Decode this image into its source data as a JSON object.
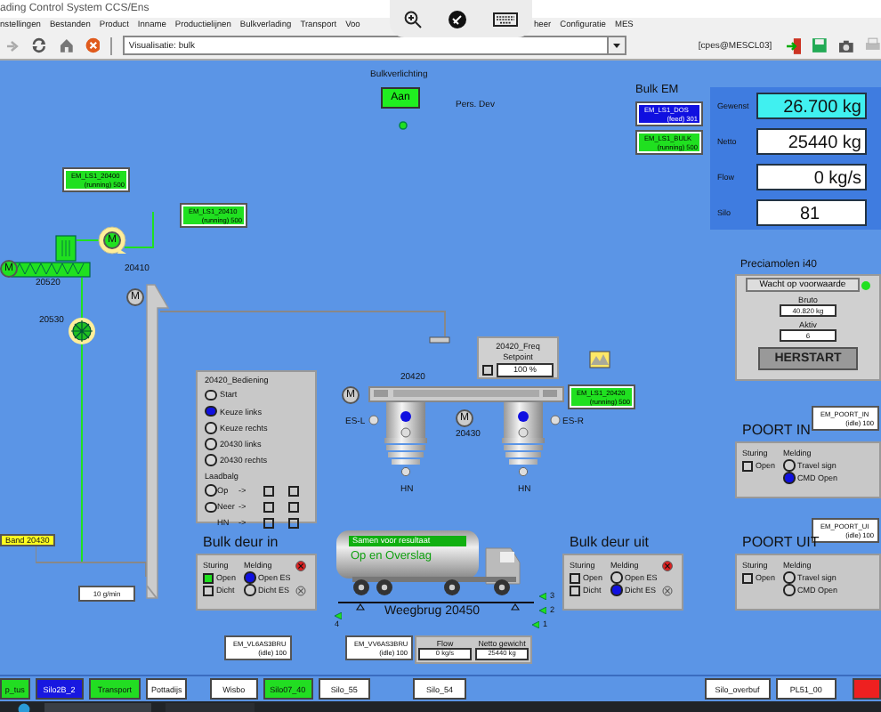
{
  "window": {
    "title": "ading Control System CCS/Ens"
  },
  "menu_left": [
    "nstellingen",
    "Bestanden",
    "Product",
    "Inname",
    "Productielijnen",
    "Bulkverlading",
    "Transport",
    "Voo"
  ],
  "menu_right": [
    "heer",
    "Configuratie",
    "MES"
  ],
  "toolbar": {
    "view": "Visualisatie: bulk",
    "user": "[cpes@MESCL03]"
  },
  "diagram": {
    "lighting": {
      "title": "Bulkverlichting",
      "button": "Aan",
      "on": true
    },
    "labels": [
      "Pers. Dev",
      "20520",
      "20530",
      "20410",
      "20420",
      "20430",
      "ES-L",
      "ES-R",
      "HN",
      "HN"
    ],
    "motors": [
      {
        "letter": "M",
        "running": true
      },
      {
        "letter": "M",
        "running": true
      },
      {
        "letter": "M",
        "running": false
      },
      {
        "letter": "M",
        "running": false
      },
      {
        "letter": "M",
        "running": false
      }
    ],
    "tags": [
      {
        "name": "EM_LS1_DOS",
        "state": "(feed) 301",
        "color": "#1010e0"
      },
      {
        "name": "EM_LS1_BULK",
        "state": "(running) 500",
        "color": "#20e020"
      },
      {
        "name": "EM_LS1_20400",
        "state": "(running) 500",
        "color": "#20e020"
      },
      {
        "name": "EM_LS1_20410",
        "state": "(running) 500",
        "color": "#20e020"
      },
      {
        "name": "EM_LS1_20420",
        "state": "(running) 500",
        "color": "#20e020"
      },
      {
        "name": "EM_POORT_IN",
        "state": "(idle) 100",
        "color": "#ffffff"
      },
      {
        "name": "EM_POORT_UI",
        "state": "(idle) 100",
        "color": "#ffffff"
      },
      {
        "name": "EM_VL6AS3BRU",
        "state": "(idle) 100",
        "color": "#ffffff"
      },
      {
        "name": "EM_VV6AS3BRU",
        "state": "(idle) 100",
        "color": "#ffffff"
      }
    ],
    "bulk_em": {
      "title": "Bulk EM",
      "rows": [
        {
          "label": "Gewenst",
          "value": "26.700 kg",
          "highlight": true
        },
        {
          "label": "Netto",
          "value": "25440 kg",
          "highlight": false
        },
        {
          "label": "Flow",
          "value": "0 kg/s",
          "highlight": false
        },
        {
          "label": "Silo",
          "value": "81",
          "highlight": false
        }
      ]
    },
    "control": {
      "title": "20420_Bediening",
      "options": [
        {
          "label": "Start",
          "selected": false
        },
        {
          "label": "Keuze links",
          "selected": true
        },
        {
          "label": "Keuze rechts",
          "selected": false
        },
        {
          "label": "20430 links",
          "selected": false
        },
        {
          "label": "20430 rechts",
          "selected": false
        }
      ],
      "section": "Laadbalg",
      "rows": [
        {
          "kind": "radio",
          "label": "Op",
          "arrow": "->",
          "selected": false,
          "checks": [
            {
              "checked": false
            },
            {
              "checked": false
            }
          ]
        },
        {
          "kind": "radio",
          "label": "Neer",
          "arrow": "->",
          "selected": false,
          "checks": [
            {
              "checked": false
            },
            {
              "checked": false
            }
          ]
        },
        {
          "kind": "plain",
          "label": "HN",
          "arrow": "->",
          "checks": [
            {
              "checked": false
            },
            {
              "checked": false
            }
          ]
        }
      ]
    },
    "freq": {
      "title": "20420_Freq",
      "setpoint_label": "Setpoint",
      "value": "100 %",
      "checked": false
    },
    "preciamolen": {
      "title": "Preciamolen i40",
      "status": "Wacht op voorwaarde",
      "ok": true,
      "fields": [
        {
          "label": "Bruto",
          "value": "40.820 kg"
        },
        {
          "label": "Aktiv",
          "value": "6"
        }
      ],
      "button": "HERSTART"
    },
    "band": {
      "label": "Band 20430",
      "reading": "10 g/min"
    },
    "doors": [
      {
        "title": "POORT IN",
        "headers": [
          "Sturing",
          "Melding"
        ],
        "controls": [
          {
            "label": "Open",
            "checked": false
          }
        ],
        "signals": [
          {
            "label": "Travel sign",
            "on": false
          },
          {
            "label": "CMD Open",
            "on": true
          }
        ]
      },
      {
        "title": "Bulk deur in",
        "headers": [
          "Sturing",
          "Melding"
        ],
        "controls": [
          {
            "label": "Open",
            "checked": true
          },
          {
            "label": "Dicht",
            "checked": false
          }
        ],
        "signals": [
          {
            "label": "Open ES",
            "on": true
          },
          {
            "label": "Dicht ES",
            "on": false
          }
        ],
        "alarm": true
      },
      {
        "title": "Bulk deur uit",
        "headers": [
          "Sturing",
          "Melding"
        ],
        "controls": [
          {
            "label": "Open",
            "checked": false
          },
          {
            "label": "Dicht",
            "checked": false
          }
        ],
        "signals": [
          {
            "label": "Open ES",
            "on": false
          },
          {
            "label": "Dicht ES",
            "on": true
          }
        ],
        "alarm": true
      },
      {
        "title": "POORT UIT",
        "headers": [
          "Sturing",
          "Melding"
        ],
        "controls": [
          {
            "label": "Open",
            "checked": false
          }
        ],
        "signals": [
          {
            "label": "Travel sign",
            "on": false
          },
          {
            "label": "CMD Open",
            "on": false
          }
        ]
      }
    ],
    "truck": {
      "status": "Samen voor resultaat",
      "text": "Op en Overslag"
    },
    "scale": {
      "label": "Weegbrug 20450",
      "markers": [
        "4",
        "3",
        "2",
        "1"
      ]
    },
    "readouts": [
      {
        "label": "Flow",
        "value": "0 kg/s"
      },
      {
        "label": "Netto gewicht",
        "value": "25440 kg"
      }
    ]
  },
  "shortcuts": [
    {
      "label": "p_tus",
      "color": "#22dd22"
    },
    {
      "label": "Silo2B_2",
      "color": "#1818e0"
    },
    {
      "label": "Transport",
      "color": "#22dd22"
    },
    {
      "label": "Pottadijs",
      "color": "#ffffff"
    },
    {
      "label": "Wisbo",
      "color": "#ffffff"
    },
    {
      "label": "Silo07_40",
      "color": "#22dd22"
    },
    {
      "label": "Silo_55",
      "color": "#ffffff"
    },
    {
      "label": "Silo_54",
      "color": "#ffffff"
    },
    {
      "label": "Silo_overbuf",
      "color": "#ffffff"
    },
    {
      "label": "PL51_00",
      "color": "#ffffff"
    },
    {
      "color": "#ee2020"
    }
  ]
}
